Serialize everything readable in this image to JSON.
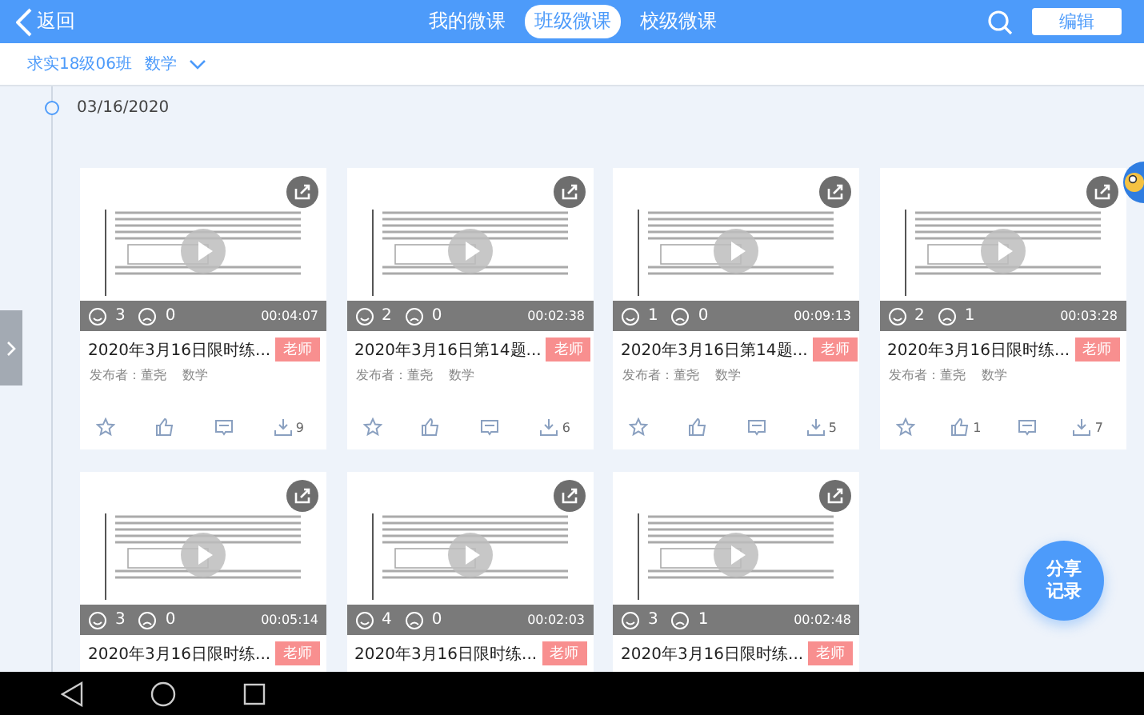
{
  "header": {
    "back": "返回",
    "tabs": [
      {
        "label": "我的微课",
        "selected": false
      },
      {
        "label": "班级微课",
        "selected": true
      },
      {
        "label": "校级微课",
        "selected": false
      }
    ],
    "edit": "编辑"
  },
  "filter": {
    "class": "求实18级06班",
    "subject": "数学"
  },
  "date": "03/16/2020",
  "cards": [
    {
      "title": "2020年3月16日限时练...",
      "badge": "老师",
      "publisher": "发布者：董尧",
      "subject": "数学",
      "likes": "3",
      "dislikes": "0",
      "duration": "00:04:07",
      "downloads": "9"
    },
    {
      "title": "2020年3月16日第14题...",
      "badge": "老师",
      "publisher": "发布者：董尧",
      "subject": "数学",
      "likes": "2",
      "dislikes": "0",
      "duration": "00:02:38",
      "downloads": "6"
    },
    {
      "title": "2020年3月16日第14题...",
      "badge": "老师",
      "publisher": "发布者：董尧",
      "subject": "数学",
      "likes": "1",
      "dislikes": "0",
      "duration": "00:09:13",
      "downloads": "5"
    },
    {
      "title": "2020年3月16日限时练...",
      "badge": "老师",
      "publisher": "发布者：董尧",
      "subject": "数学",
      "likes": "2",
      "dislikes": "1",
      "duration": "00:03:28",
      "thumb_count": "1",
      "downloads": "7"
    },
    {
      "title": "2020年3月16日限时练...",
      "badge": "老师",
      "likes": "3",
      "dislikes": "0",
      "duration": "00:05:14"
    },
    {
      "title": "2020年3月16日限时练...",
      "badge": "老师",
      "likes": "4",
      "dislikes": "0",
      "duration": "00:02:03"
    },
    {
      "title": "2020年3月16日限时练...",
      "badge": "老师",
      "likes": "3",
      "dislikes": "1",
      "duration": "00:02:48"
    }
  ],
  "share_records": "分享记录"
}
